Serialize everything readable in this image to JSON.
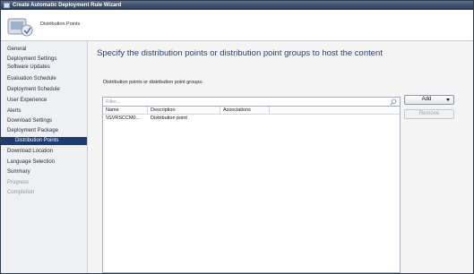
{
  "window": {
    "title": "Create Automatic Deployment Rule Wizard"
  },
  "header": {
    "page_name": "Distribution Points"
  },
  "nav": {
    "items": [
      {
        "label": "General",
        "state": "normal",
        "indent": false
      },
      {
        "label": "Deployment Settings",
        "state": "normal",
        "indent": false
      },
      {
        "label": "Software Updates",
        "state": "normal",
        "indent": false
      },
      {
        "label": "Evaluation Schedule",
        "state": "normal",
        "indent": false
      },
      {
        "label": "Deployment Schedule",
        "state": "normal",
        "indent": false
      },
      {
        "label": "User Experience",
        "state": "normal",
        "indent": false
      },
      {
        "label": "Alerts",
        "state": "normal",
        "indent": false
      },
      {
        "label": "Download Settings",
        "state": "normal",
        "indent": false
      },
      {
        "label": "Deployment Package",
        "state": "normal",
        "indent": false
      },
      {
        "label": "Distribution Points",
        "state": "active",
        "indent": true
      },
      {
        "label": "Download Location",
        "state": "normal",
        "indent": false
      },
      {
        "label": "Language Selection",
        "state": "normal",
        "indent": false
      },
      {
        "label": "Summary",
        "state": "normal",
        "indent": false
      },
      {
        "label": "Progress",
        "state": "disabled",
        "indent": false
      },
      {
        "label": "Completion",
        "state": "disabled",
        "indent": false
      }
    ]
  },
  "main": {
    "heading": "Specify the distribution points or distribution point groups to host the content",
    "list_label": "Distribution points or distribution point groups:",
    "filter_placeholder": "Filter...",
    "columns": [
      "Name",
      "Description",
      "Associations"
    ],
    "rows": [
      {
        "name": "\\\\SVRSCCM0...",
        "description": "Distribution point",
        "associations": ""
      }
    ],
    "add_button": "Add",
    "remove_button": "Remove"
  },
  "icons": {
    "title": "wizard-window-icon",
    "header": "distribution-points-icon",
    "filter": "search-icon",
    "add_dropdown": "dropdown-arrow-icon"
  },
  "colors": {
    "accent": "#1f3b73",
    "heading": "#1f3f86",
    "titlebar": "#3a4b68"
  }
}
